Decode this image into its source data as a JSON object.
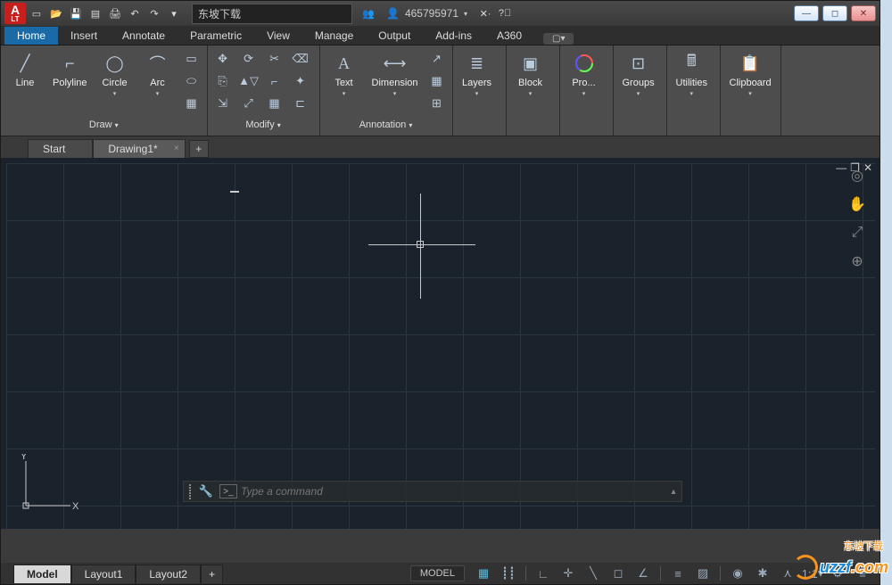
{
  "app": {
    "logo_main": "A",
    "logo_sub": "LT"
  },
  "titlebar": {
    "search_text": "东坡下载",
    "user_id": "465795971"
  },
  "tabs": {
    "items": [
      "Home",
      "Insert",
      "Annotate",
      "Parametric",
      "View",
      "Manage",
      "Output",
      "Add-ins",
      "A360"
    ],
    "active": 0
  },
  "ribbon": {
    "draw": {
      "title": "Draw",
      "line": "Line",
      "polyline": "Polyline",
      "circle": "Circle",
      "arc": "Arc"
    },
    "modify": {
      "title": "Modify"
    },
    "annotation": {
      "title": "Annotation",
      "text": "Text",
      "dimension": "Dimension"
    },
    "layers": "Layers",
    "block": "Block",
    "properties": "Pro...",
    "groups": "Groups",
    "utilities": "Utilities",
    "clipboard": "Clipboard"
  },
  "doc_tabs": {
    "start": "Start",
    "drawing": "Drawing1*"
  },
  "cmd": {
    "placeholder": "Type a command"
  },
  "layout_tabs": {
    "model": "Model",
    "layout1": "Layout1",
    "layout2": "Layout2"
  },
  "status": {
    "model": "MODEL",
    "scale": "1:1"
  },
  "ucs": {
    "x": "X",
    "y": "Y"
  },
  "watermark": {
    "text": "uzzf",
    "suffix": ".com",
    "cn": "东坡下载"
  }
}
